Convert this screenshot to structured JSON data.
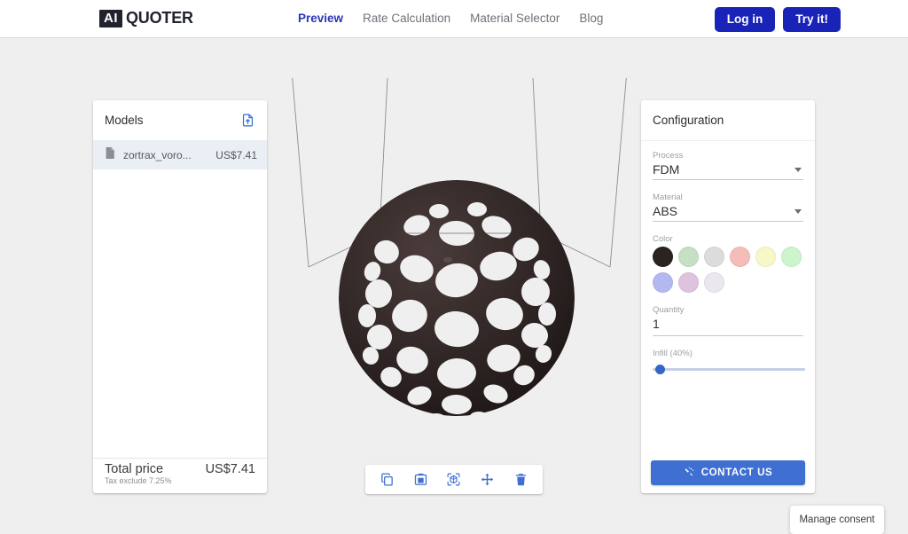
{
  "header": {
    "logo_badge": "AI",
    "logo_word": "QUOTER",
    "nav": [
      {
        "label": "Preview",
        "active": true
      },
      {
        "label": "Rate Calculation",
        "active": false
      },
      {
        "label": "Material Selector",
        "active": false
      },
      {
        "label": "Blog",
        "active": false
      }
    ],
    "login_label": "Log in",
    "try_label": "Try it!",
    "accent_color": "#1a23b8",
    "active_nav_color": "#2b35b5"
  },
  "models_panel": {
    "title": "Models",
    "upload_icon": "file-upload-icon",
    "rows": [
      {
        "icon": "file-icon",
        "name": "zortrax_voro...",
        "price": "US$7.41",
        "selected": true
      }
    ],
    "footer": {
      "total_label": "Total price",
      "tax_note": "Tax exclude 7.25%",
      "total_price": "US$7.41"
    }
  },
  "viewport": {
    "model_name": "voronoi-sphere",
    "model_color": "#2a2020",
    "build_volume_line_color": "#8c8c8c",
    "background": "#efefef"
  },
  "toolbar": {
    "buttons": [
      {
        "icon": "duplicate-icon",
        "label": "Duplicate"
      },
      {
        "icon": "paste-icon",
        "label": "Paste"
      },
      {
        "icon": "center-view-icon",
        "label": "Center view"
      },
      {
        "icon": "move-icon",
        "label": "Move"
      },
      {
        "icon": "delete-icon",
        "label": "Delete"
      }
    ]
  },
  "config_panel": {
    "title": "Configuration",
    "process": {
      "label": "Process",
      "value": "FDM"
    },
    "material": {
      "label": "Material",
      "value": "ABS"
    },
    "color": {
      "label": "Color",
      "selected_index": 0,
      "swatches": [
        "#2b2322",
        "#c6e0c4",
        "#dcdcdc",
        "#f5bdb8",
        "#f7f7c8",
        "#cdf5cb",
        "#b4b8f0",
        "#ddc3de",
        "#ece6ee"
      ]
    },
    "quantity": {
      "label": "Quantity",
      "value": "1"
    },
    "infill": {
      "label": "Infill (40%)",
      "percent": 40,
      "thumb_position_percent": 2
    },
    "contact_button": {
      "label": "CONTACT US",
      "icon": "contact-icon",
      "color": "#3f6fd0"
    }
  },
  "consent": {
    "label": "Manage consent"
  }
}
